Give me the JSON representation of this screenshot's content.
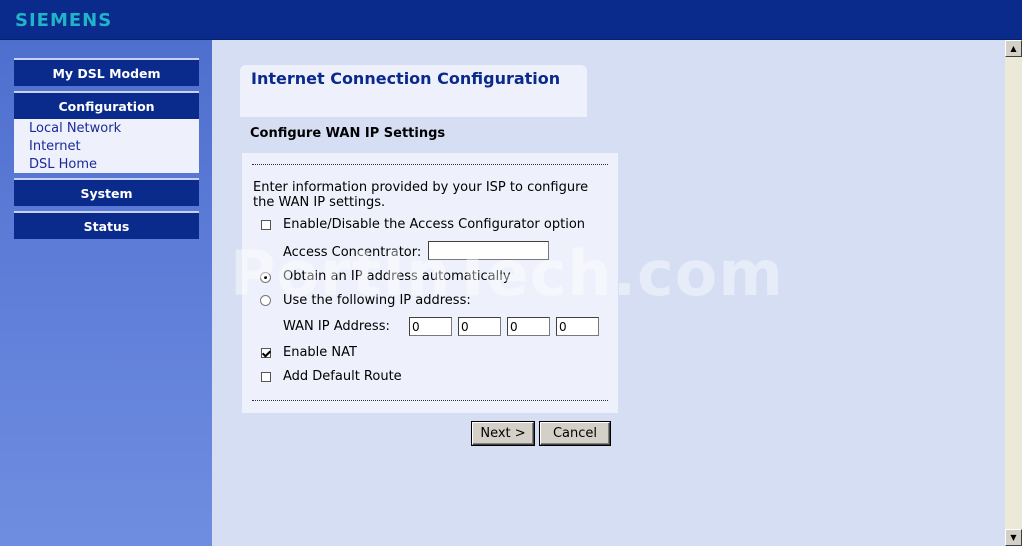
{
  "header": {
    "brand": "SIEMENS"
  },
  "sidebar": {
    "items": [
      {
        "label": "My DSL Modem"
      },
      {
        "label": "Configuration"
      },
      {
        "label": "System"
      },
      {
        "label": "Status"
      }
    ],
    "submenu": [
      {
        "label": "Local Network"
      },
      {
        "label": "Internet"
      },
      {
        "label": "DSL Home"
      }
    ]
  },
  "main": {
    "title": "Internet Connection Configuration",
    "subtitle": "Configure WAN IP Settings",
    "intro": "Enter information provided by your ISP to configure the WAN IP settings.",
    "access_configurator": {
      "label": "Enable/Disable the Access Configurator option",
      "checked": false
    },
    "access_concentrator": {
      "label": "Access Concentrator:",
      "value": ""
    },
    "obtain_auto": {
      "label": "Obtain an IP address automatically",
      "selected": true
    },
    "use_following": {
      "label": "Use the following IP address:",
      "selected": false
    },
    "wan_ip": {
      "label": "WAN IP Address:",
      "octets": [
        "0",
        "0",
        "0",
        "0"
      ]
    },
    "enable_nat": {
      "label": "Enable NAT",
      "checked": true
    },
    "default_route": {
      "label": "Add Default Route",
      "checked": false
    },
    "buttons": {
      "next": "Next >",
      "cancel": "Cancel"
    }
  },
  "watermark": "PortInTech.com",
  "colors": {
    "topbar": "#0a2a8c",
    "brand": "#20b4c8",
    "nav_button": "#0a2a8c",
    "sidebar": "#5b7ad6",
    "content_bg": "#d6def4",
    "panel_bg": "#eef1fb"
  }
}
